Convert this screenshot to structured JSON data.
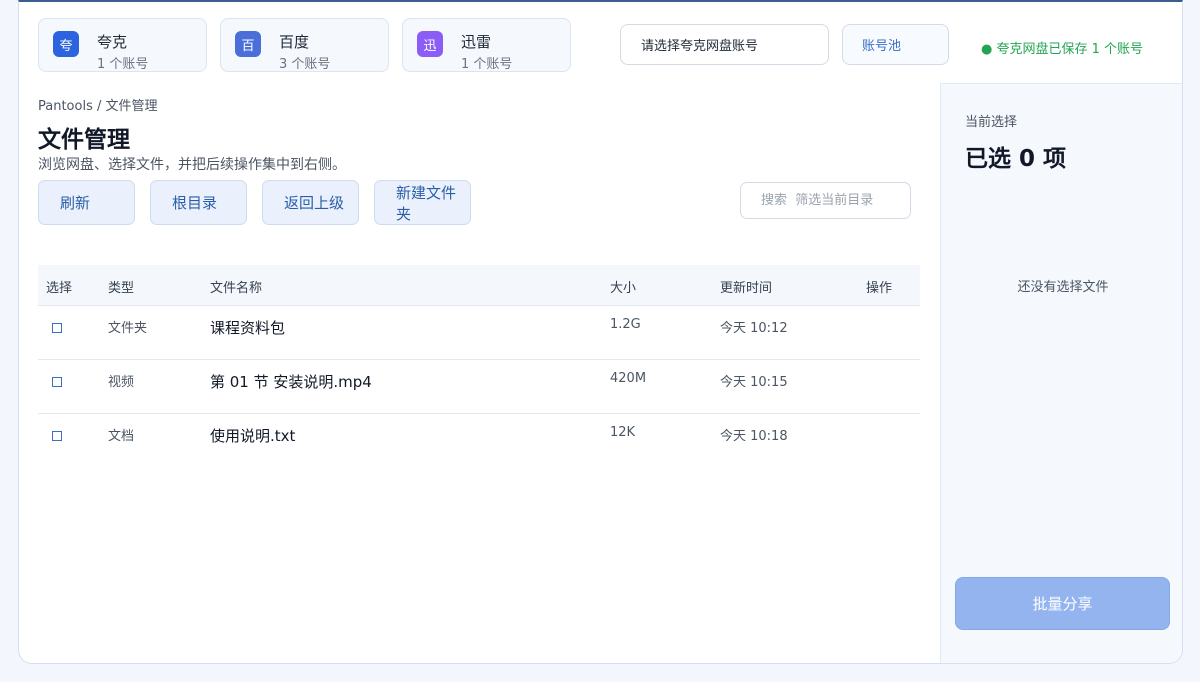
{
  "providers": [
    {
      "icon": "夸",
      "name": "夸克",
      "count": "1 个账号",
      "color": "#2c64e0"
    },
    {
      "icon": "百",
      "name": "百度",
      "count": "3 个账号",
      "color": "#4a6fd8"
    },
    {
      "icon": "迅",
      "name": "迅雷",
      "count": "1 个账号",
      "color": "#8b5cf6"
    }
  ],
  "header": {
    "account_select": "请选择夸克网盘账号",
    "pool_button": "账号池",
    "save_status": "● 夸克网盘已保存 1 个账号"
  },
  "main": {
    "breadcrumb": "Pantools / 文件管理",
    "title": "文件管理",
    "subtitle": "浏览网盘、选择文件，并把后续操作集中到右侧。",
    "buttons": {
      "refresh": "刷新",
      "root": "根目录",
      "back": "返回上级",
      "new_folder": "新建文件夹"
    },
    "search": {
      "placeholder": "搜索  筛选当前目录"
    }
  },
  "table": {
    "headers": [
      "选择",
      "类型",
      "文件名称",
      "大小",
      "更新时间",
      "操作"
    ],
    "rows": [
      {
        "checkbox": "□",
        "type": "文件夹",
        "name": "课程资料包",
        "size": "1.2G",
        "time": "今天 10:12"
      },
      {
        "checkbox": "□",
        "type": "视频",
        "name": "第 01 节 安装说明.mp4",
        "size": "420M",
        "time": "今天 10:15"
      },
      {
        "checkbox": "□",
        "type": "文档",
        "name": "使用说明.txt",
        "size": "12K",
        "time": "今天 10:18"
      }
    ]
  },
  "side": {
    "label": "当前选择",
    "count": "已选 0 项",
    "empty": "还没有选择文件",
    "share_button": "批量分享"
  },
  "colors": {
    "accent": "#2b5ea7",
    "success": "#22a553",
    "share_disabled": "#93b4ee"
  }
}
